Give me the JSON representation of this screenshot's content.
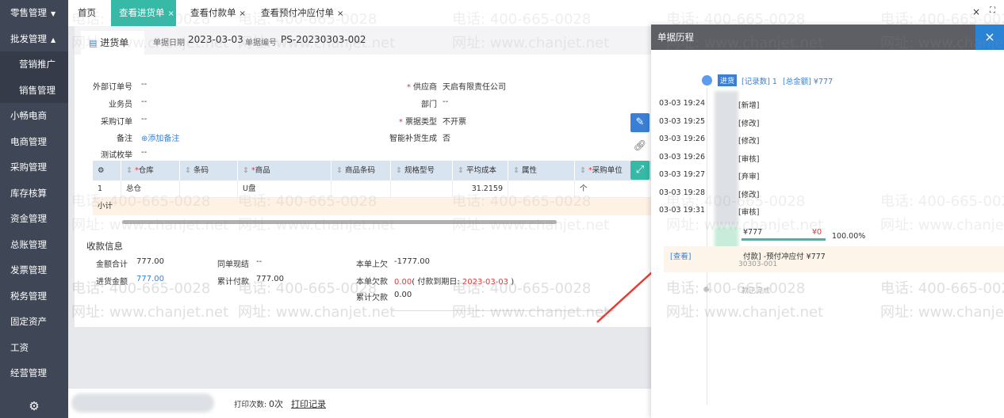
{
  "sidebar": {
    "items": [
      {
        "label": "零售管理",
        "arrow": "▼",
        "sub": false
      },
      {
        "label": "批发管理",
        "arrow": "▲",
        "sub": false
      },
      {
        "label": "营销推广",
        "arrow": "",
        "sub": true
      },
      {
        "label": "销售管理",
        "arrow": "",
        "sub": true
      },
      {
        "label": "小畅电商",
        "arrow": "",
        "sub": false
      },
      {
        "label": "电商管理",
        "arrow": "",
        "sub": false
      },
      {
        "label": "采购管理",
        "arrow": "",
        "sub": false
      },
      {
        "label": "库存核算",
        "arrow": "",
        "sub": false
      },
      {
        "label": "资金管理",
        "arrow": "",
        "sub": false
      },
      {
        "label": "总账管理",
        "arrow": "",
        "sub": false
      },
      {
        "label": "发票管理",
        "arrow": "",
        "sub": false
      },
      {
        "label": "税务管理",
        "arrow": "",
        "sub": false
      },
      {
        "label": "固定资产",
        "arrow": "",
        "sub": false
      },
      {
        "label": "工资",
        "arrow": "",
        "sub": false
      },
      {
        "label": "经营管理",
        "arrow": "",
        "sub": false
      }
    ],
    "gear_icon": "gear-icon"
  },
  "tabs": {
    "home": "首页",
    "t1": "查看进货单",
    "t2": "查看付款单",
    "t3": "查看预付冲应付单",
    "close": "×"
  },
  "window": {
    "close": "×",
    "expand": "⛶"
  },
  "doc": {
    "tab_label": "进货单",
    "date_label": "单据日期",
    "date": "2023-03-03",
    "no_label": "单据编号",
    "no": "PS-20230303-002"
  },
  "form": {
    "ext_order_label": "外部订单号",
    "ext_order": "--",
    "salesman_label": "业务员",
    "salesman": "--",
    "po_label": "采购订单",
    "po": "--",
    "remark_label": "备注",
    "remark_add": "添加备注",
    "test_label": "测试枚举",
    "test": "--",
    "supplier_label": "供应商",
    "supplier": "天启有限责任公司",
    "dept_label": "部门",
    "dept": "--",
    "invoice_label": "票据类型",
    "invoice": "不开票",
    "smart_label": "智能补货生成",
    "smart": "否",
    "req_mark": "*"
  },
  "grid": {
    "headers": [
      "仓库",
      "条码",
      "商品",
      "商品条码",
      "规格型号",
      "平均成本",
      "属性",
      "采购单位"
    ],
    "required": [
      true,
      false,
      true,
      false,
      false,
      false,
      false,
      true
    ],
    "row": {
      "no": "1",
      "warehouse": "总仓",
      "product": "U盘",
      "avg_cost": "31.2159",
      "unit": "个"
    },
    "subtotal_label": "小计"
  },
  "receipt": {
    "title": "收款信息",
    "total_label": "金额合计",
    "total": "777.00",
    "purchase_amt_label": "进货金额",
    "purchase_amt": "777.00",
    "same_settle_label": "同单现结",
    "same_settle": "--",
    "cum_pay_label": "累计付款",
    "cum_pay": "777.00",
    "prev_owe_label": "本单上欠",
    "prev_owe": "-1777.00",
    "owe_label": "本单欠款",
    "owe": "0.00",
    "due_prefix": "( 付款到期日: ",
    "due_date": "2023-03-03",
    "due_suffix": " )",
    "cum_owe_label": "累计欠款",
    "cum_owe": "0.00"
  },
  "bottom": {
    "print_count_label": "打印次数:",
    "print_count": "0次",
    "print_record": "打印记录"
  },
  "panel": {
    "title": "单据历程",
    "close": "×",
    "summary_tag": "进货",
    "summary_records": "[记录数] 1",
    "summary_amount": "[总金额] ¥777",
    "entries": [
      {
        "time": "03-03 19:24",
        "action": "[新增]"
      },
      {
        "time": "03-03 19:25",
        "action": "[修改]"
      },
      {
        "time": "03-03 19:26",
        "action": "[修改]"
      },
      {
        "time": "03-03 19:26",
        "action": "[审核]"
      },
      {
        "time": "03-03 19:27",
        "action": "[弃审]"
      },
      {
        "time": "03-03 19:28",
        "action": "[修改]"
      },
      {
        "time": "03-03 19:31",
        "action": "[审核]"
      }
    ],
    "amount": "¥777",
    "zero": "¥0",
    "progress_pct": "100.00%",
    "progress_value": 1.0,
    "view_link": "[查看]",
    "linked_doc": "付款] -预付冲应付 ¥777",
    "linked_no": "30303-001",
    "complete_label": "款已完成"
  },
  "watermark": {
    "phone": "电话: 400-665-0028",
    "site": "网址: www.chanjet.net"
  },
  "colors": {
    "teal": "#36b9a7",
    "sidebar": "#3f4655",
    "blue": "#3a7fd5",
    "red": "#e23b3b",
    "panel_head": "#5d5f65"
  }
}
